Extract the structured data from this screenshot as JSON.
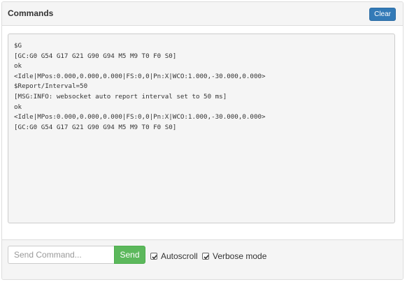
{
  "header": {
    "title": "Commands",
    "clear_label": "Clear"
  },
  "console": {
    "lines": [
      "$G",
      "[GC:G0 G54 G17 G21 G90 G94 M5 M9 T0 F0 S0]",
      "ok",
      "<Idle|MPos:0.000,0.000,0.000|FS:0,0|Pn:X|WCO:1.000,-30.000,0.000>",
      "$Report/Interval=50",
      "[MSG:INFO: websocket auto report interval set to 50 ms]",
      "ok",
      "<Idle|MPos:0.000,0.000,0.000|FS:0,0|Pn:X|WCO:1.000,-30.000,0.000>",
      "[GC:G0 G54 G17 G21 G90 G94 M5 M9 T0 F0 S0]"
    ]
  },
  "footer": {
    "command_placeholder": "Send Command...",
    "command_value": "",
    "send_label": "Send",
    "autoscroll_label": "Autoscroll",
    "autoscroll_checked": true,
    "verbose_label": "Verbose mode",
    "verbose_checked": true
  },
  "colors": {
    "primary": "#337ab7",
    "success": "#5cb85c",
    "panel_bg": "#f5f5f5"
  },
  "icons": {
    "checkbox_checked": "check-icon"
  }
}
